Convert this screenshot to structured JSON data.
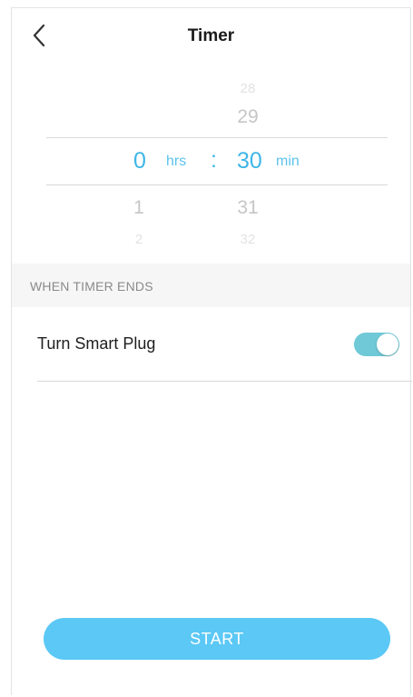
{
  "header": {
    "title": "Timer",
    "back_icon": "chevron-left-icon"
  },
  "picker": {
    "hours": {
      "above": [
        "",
        ""
      ],
      "selected": "0",
      "below": [
        "1",
        "2"
      ],
      "unit": "hrs"
    },
    "minutes": {
      "above": [
        "28",
        "29"
      ],
      "selected": "30",
      "below": [
        "31",
        "32"
      ],
      "unit": "min"
    },
    "separator": ":",
    "selected_color": "#3fb6e6"
  },
  "section": {
    "title": "WHEN TIMER ENDS"
  },
  "action_row": {
    "label": "Turn Smart Plug",
    "toggle_on": true,
    "toggle_color": "#6fc9d6"
  },
  "start_button": {
    "label": "START",
    "color": "#5bc8f5"
  }
}
